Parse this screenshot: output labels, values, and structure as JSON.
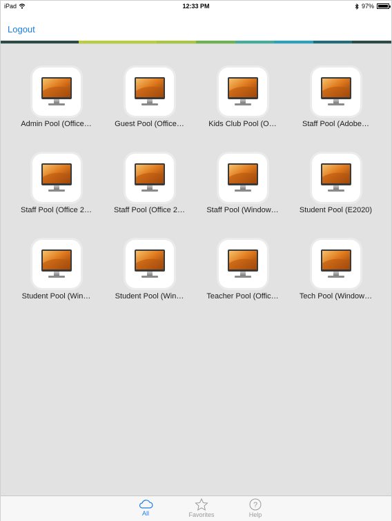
{
  "status_bar": {
    "device": "iPad",
    "time": "12:33 PM",
    "battery": "97%",
    "battery_level": 0.97,
    "wifi_icon": "wifi-icon",
    "bluetooth_icon": "bluetooth-icon"
  },
  "nav": {
    "logout_label": "Logout"
  },
  "accent_colors": [
    "#2b4b45",
    "#2b4b45",
    "#b8cf3a",
    "#b8cf3a",
    "#a7c73c",
    "#6bb54a",
    "#3fae9a",
    "#27a3c1",
    "#1f6f7a",
    "#2b4b45"
  ],
  "pools": [
    {
      "label": "Admin Pool (Office…"
    },
    {
      "label": "Guest Pool (Office…"
    },
    {
      "label": "Kids Club Pool (O…"
    },
    {
      "label": "Staff Pool (Adobe…"
    },
    {
      "label": "Staff Pool (Office 2…"
    },
    {
      "label": "Staff Pool (Office 2…"
    },
    {
      "label": "Staff Pool (Window…"
    },
    {
      "label": "Student Pool (E2020)"
    },
    {
      "label": "Student Pool (Win…"
    },
    {
      "label": "Student Pool (Win…"
    },
    {
      "label": "Teacher Pool (Offic…"
    },
    {
      "label": "Tech Pool (Window…"
    }
  ],
  "tabs": {
    "all": {
      "label": "All",
      "icon": "cloud-icon"
    },
    "favorites": {
      "label": "Favorites",
      "icon": "star-icon"
    },
    "help": {
      "label": "Help",
      "icon": "help-icon"
    }
  },
  "colors": {
    "accent_blue": "#1a7fe6",
    "background": "#e2e2e2"
  }
}
